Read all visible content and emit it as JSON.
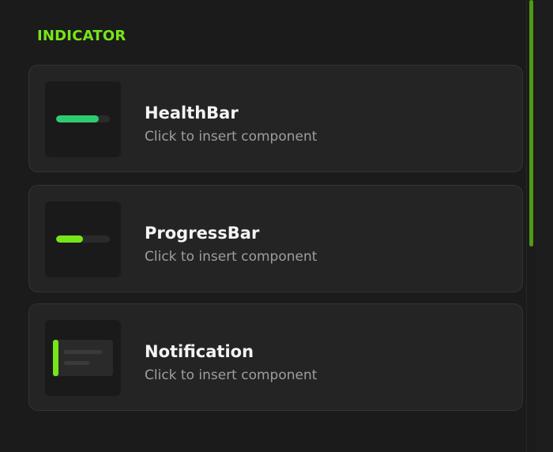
{
  "section": {
    "title": "INDICATOR",
    "accent_color": "#76e51a"
  },
  "components": [
    {
      "name": "HealthBar",
      "hint": "Click to insert component",
      "preview": {
        "type": "bar",
        "fill_fraction": 0.8,
        "fill_color": "#2ecc71"
      }
    },
    {
      "name": "ProgressBar",
      "hint": "Click to insert component",
      "preview": {
        "type": "bar",
        "fill_fraction": 0.5,
        "fill_color": "#76e51a"
      }
    },
    {
      "name": "Notification",
      "hint": "Click to insert component",
      "preview": {
        "type": "notification",
        "accent_color": "#76e51a"
      }
    }
  ],
  "scrollbar": {
    "thumb_color": "#4f9a15"
  }
}
